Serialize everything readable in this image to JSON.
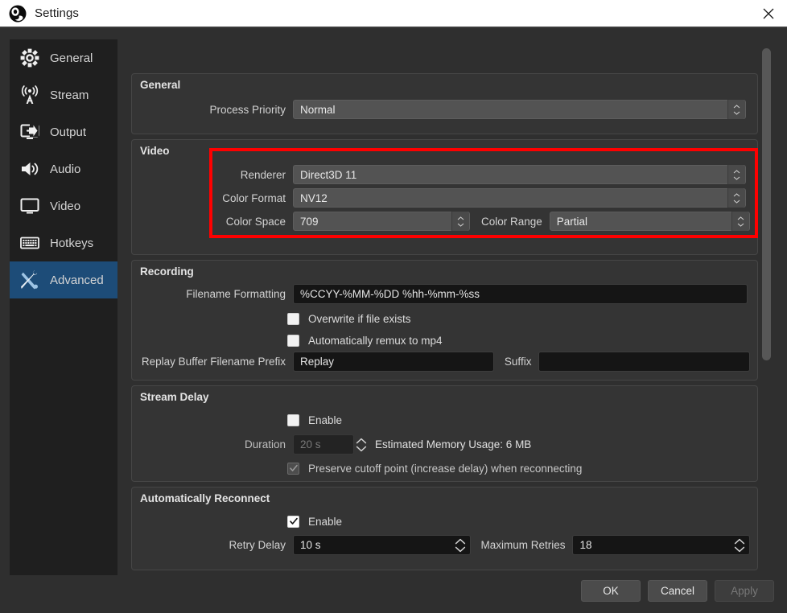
{
  "window": {
    "title": "Settings",
    "logo_icon": "obs-logo-icon",
    "close_icon": "close-icon",
    "accent_selected": "#1d4c78",
    "highlight_color": "#fe0000"
  },
  "sidebar": {
    "items": [
      {
        "label": "General",
        "icon": "gear-icon",
        "selected": false
      },
      {
        "label": "Stream",
        "icon": "broadcast-icon",
        "selected": false
      },
      {
        "label": "Output",
        "icon": "output-icon",
        "selected": false
      },
      {
        "label": "Audio",
        "icon": "speaker-icon",
        "selected": false
      },
      {
        "label": "Video",
        "icon": "monitor-icon",
        "selected": false
      },
      {
        "label": "Hotkeys",
        "icon": "keyboard-icon",
        "selected": false
      },
      {
        "label": "Advanced",
        "icon": "tools-icon",
        "selected": true
      }
    ]
  },
  "general": {
    "title": "General",
    "process_priority": {
      "label": "Process Priority",
      "value": "Normal"
    }
  },
  "video": {
    "title": "Video",
    "renderer": {
      "label": "Renderer",
      "value": "Direct3D 11"
    },
    "color_format": {
      "label": "Color Format",
      "value": "NV12"
    },
    "color_space": {
      "label": "Color Space",
      "value": "709"
    },
    "color_range": {
      "label": "Color Range",
      "value": "Partial"
    }
  },
  "recording": {
    "title": "Recording",
    "filename_formatting": {
      "label": "Filename Formatting",
      "value": "%CCYY-%MM-%DD %hh-%mm-%ss"
    },
    "overwrite": {
      "label": "Overwrite if file exists",
      "checked": false
    },
    "remux": {
      "label": "Automatically remux to mp4",
      "checked": false
    },
    "replay_prefix": {
      "label": "Replay Buffer Filename Prefix",
      "value": "Replay"
    },
    "suffix": {
      "label": "Suffix",
      "value": ""
    }
  },
  "stream_delay": {
    "title": "Stream Delay",
    "enable": {
      "label": "Enable",
      "checked": false
    },
    "duration": {
      "label": "Duration",
      "value": "20 s"
    },
    "memory_usage": "Estimated Memory Usage: 6 MB",
    "preserve": {
      "label": "Preserve cutoff point (increase delay) when reconnecting",
      "checked": true
    }
  },
  "reconnect": {
    "title": "Automatically Reconnect",
    "enable": {
      "label": "Enable",
      "checked": true
    },
    "retry_delay": {
      "label": "Retry Delay",
      "value": "10 s"
    },
    "max_retries": {
      "label": "Maximum Retries",
      "value": "18"
    }
  },
  "buttons": {
    "ok": "OK",
    "cancel": "Cancel",
    "apply": "Apply"
  }
}
